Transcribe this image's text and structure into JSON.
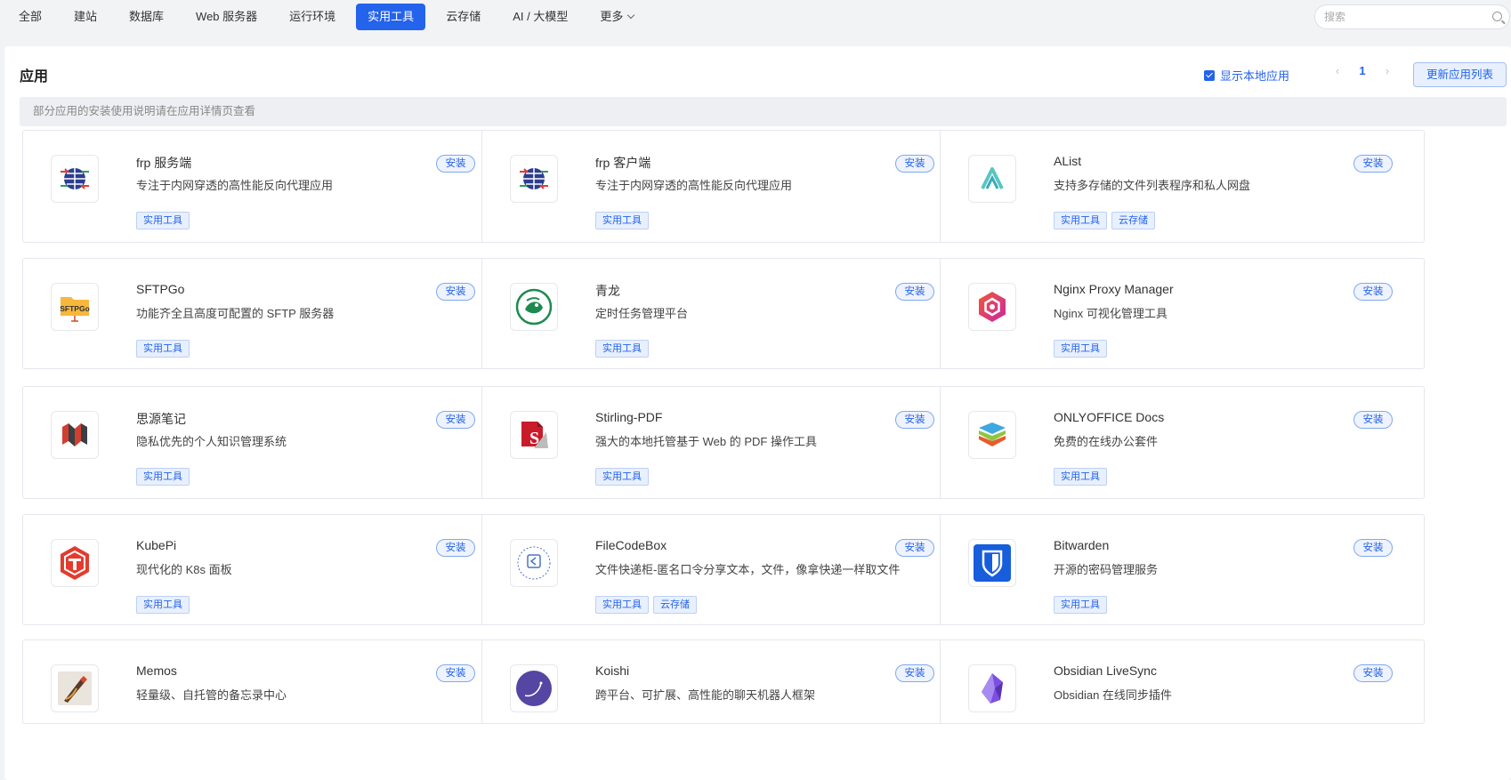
{
  "nav": {
    "tabs": [
      "全部",
      "建站",
      "数据库",
      "Web 服务器",
      "运行环境",
      "实用工具",
      "云存储",
      "AI / 大模型",
      "更多"
    ],
    "active_index": 5
  },
  "search": {
    "placeholder": "搜索"
  },
  "panel": {
    "title": "应用",
    "show_local_label": "显示本地应用",
    "show_local_checked": true,
    "pager": {
      "prev": "‹",
      "current": "1",
      "next": "›"
    },
    "refresh_label": "更新应用列表",
    "notice": "部分应用的安装使用说明请在应用详情页查看"
  },
  "install_label": "安装",
  "apps": [
    {
      "name": "frp 服务端",
      "desc": "专注于内网穿透的高性能反向代理应用",
      "tags": [
        "实用工具"
      ],
      "icon": "frp-icon"
    },
    {
      "name": "frp 客户端",
      "desc": "专注于内网穿透的高性能反向代理应用",
      "tags": [
        "实用工具"
      ],
      "icon": "frp-icon"
    },
    {
      "name": "AList",
      "desc": "支持多存储的文件列表程序和私人网盘",
      "tags": [
        "实用工具",
        "云存储"
      ],
      "icon": "alist-icon"
    },
    {
      "name": "SFTPGo",
      "desc": "功能齐全且高度可配置的 SFTP 服务器",
      "tags": [
        "实用工具"
      ],
      "icon": "sftpgo-icon",
      "icon_text": "SFTPGo"
    },
    {
      "name": "青龙",
      "desc": "定时任务管理平台",
      "tags": [
        "实用工具"
      ],
      "icon": "qinglong-icon"
    },
    {
      "name": "Nginx Proxy Manager",
      "desc": "Nginx 可视化管理工具",
      "tags": [
        "实用工具"
      ],
      "icon": "nginx-proxy-manager-icon"
    },
    {
      "name": "思源笔记",
      "desc": "隐私优先的个人知识管理系统",
      "tags": [
        "实用工具"
      ],
      "icon": "siyuan-icon"
    },
    {
      "name": "Stirling-PDF",
      "desc": "强大的本地托管基于 Web 的 PDF 操作工具",
      "tags": [
        "实用工具"
      ],
      "icon": "stirling-pdf-icon",
      "icon_text": "S"
    },
    {
      "name": "ONLYOFFICE Docs",
      "desc": "免费的在线办公套件",
      "tags": [
        "实用工具"
      ],
      "icon": "onlyoffice-icon"
    },
    {
      "name": "KubePi",
      "desc": "现代化的 K8s 面板",
      "tags": [
        "实用工具"
      ],
      "icon": "kubepi-icon"
    },
    {
      "name": "FileCodeBox",
      "desc": "文件快递柜-匿名口令分享文本，文件，像拿快递一样取文件",
      "tags": [
        "实用工具",
        "云存储"
      ],
      "icon": "filecodebox-icon"
    },
    {
      "name": "Bitwarden",
      "desc": "开源的密码管理服务",
      "tags": [
        "实用工具"
      ],
      "icon": "bitwarden-icon"
    },
    {
      "name": "Memos",
      "desc": "轻量级、自托管的备忘录中心",
      "tags": [],
      "icon": "memos-icon"
    },
    {
      "name": "Koishi",
      "desc": "跨平台、可扩展、高性能的聊天机器人框架",
      "tags": [],
      "icon": "koishi-icon"
    },
    {
      "name": "Obsidian LiveSync",
      "desc": "Obsidian 在线同步插件",
      "tags": [],
      "icon": "obsidian-icon"
    }
  ],
  "colors": {
    "accent": "#2463eb",
    "tag_bg": "#e8f0fe",
    "panel_bg": "#ffffff",
    "page_bg": "#f2f3f5"
  }
}
